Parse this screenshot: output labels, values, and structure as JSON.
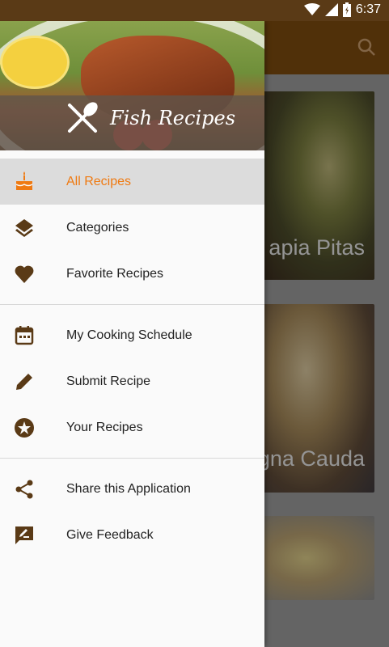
{
  "status_bar": {
    "time": "6:37"
  },
  "background": {
    "cards": [
      {
        "title": "apia Pitas"
      },
      {
        "title": "gna Cauda"
      },
      {
        "title": ""
      }
    ]
  },
  "drawer": {
    "header": {
      "title": "Fish Recipes"
    },
    "sections": [
      [
        {
          "label": "All Recipes",
          "icon": "cake-icon",
          "selected": true
        },
        {
          "label": "Categories",
          "icon": "layers-icon"
        },
        {
          "label": "Favorite Recipes",
          "icon": "heart-icon"
        }
      ],
      [
        {
          "label": "My Cooking Schedule",
          "icon": "calendar-icon"
        },
        {
          "label": "Submit Recipe",
          "icon": "pencil-icon"
        },
        {
          "label": "Your Recipes",
          "icon": "star-circle-icon"
        }
      ],
      [
        {
          "label": "Share this Application",
          "icon": "share-icon"
        },
        {
          "label": "Give Feedback",
          "icon": "feedback-icon"
        }
      ]
    ]
  },
  "colors": {
    "accent": "#ef7a12",
    "icon": "#5a3a16",
    "appbar": "#7b4a0f"
  }
}
